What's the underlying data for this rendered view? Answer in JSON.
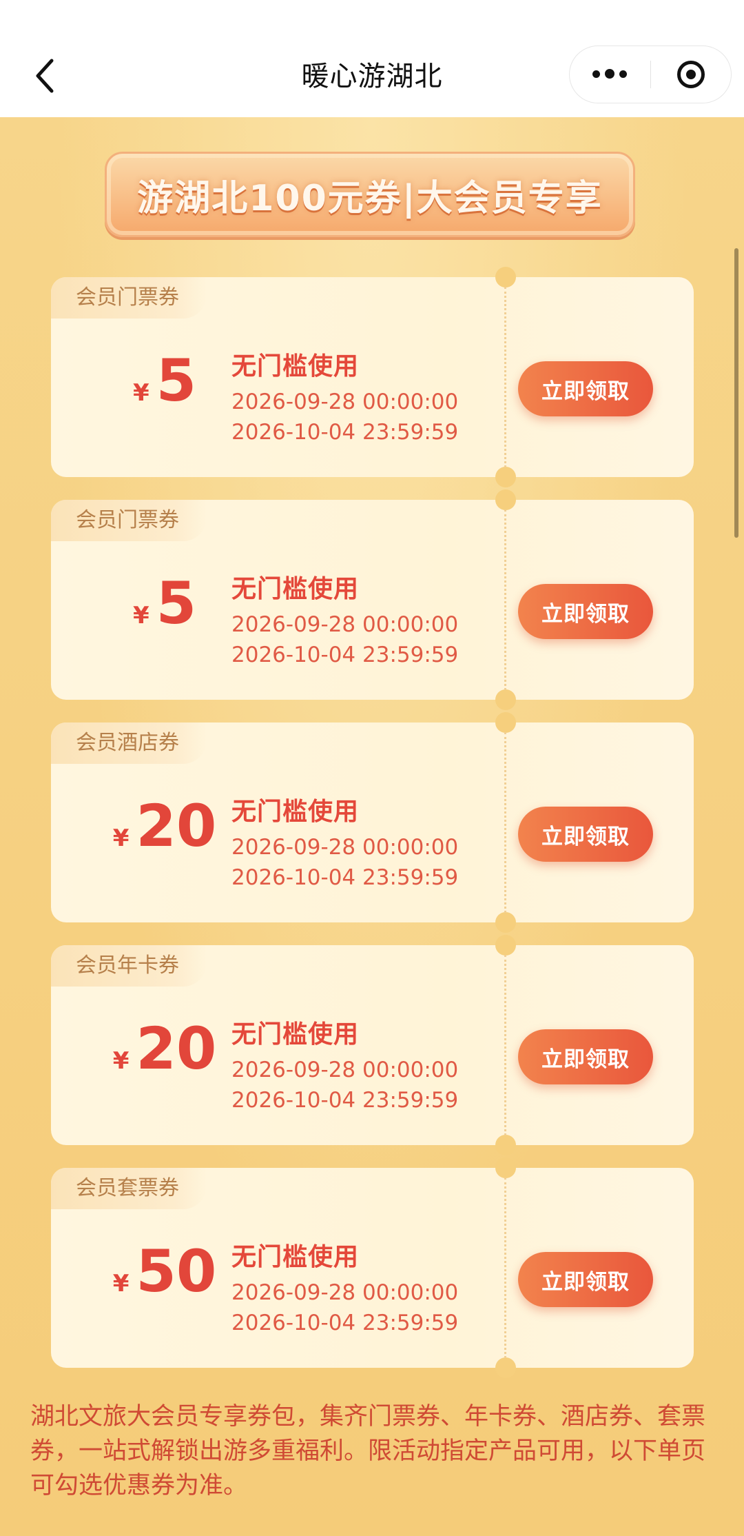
{
  "header": {
    "title": "暖心游湖北",
    "back_icon": "chevron-left-icon",
    "more_icon": "more-dots-icon",
    "close_icon": "target-circle-icon"
  },
  "banner": {
    "text": "游湖北100元券|大会员专享"
  },
  "coupons": [
    {
      "tag": "会员门票券",
      "currency": "¥",
      "amount": "5",
      "rule": "无门槛使用",
      "start": "2026-09-28 00:00:00",
      "end": "2026-10-04 23:59:59",
      "button": "立即领取"
    },
    {
      "tag": "会员门票券",
      "currency": "¥",
      "amount": "5",
      "rule": "无门槛使用",
      "start": "2026-09-28 00:00:00",
      "end": "2026-10-04 23:59:59",
      "button": "立即领取"
    },
    {
      "tag": "会员酒店券",
      "currency": "¥",
      "amount": "20",
      "rule": "无门槛使用",
      "start": "2026-09-28 00:00:00",
      "end": "2026-10-04 23:59:59",
      "button": "立即领取"
    },
    {
      "tag": "会员年卡券",
      "currency": "¥",
      "amount": "20",
      "rule": "无门槛使用",
      "start": "2026-09-28 00:00:00",
      "end": "2026-10-04 23:59:59",
      "button": "立即领取"
    },
    {
      "tag": "会员套票券",
      "currency": "¥",
      "amount": "50",
      "rule": "无门槛使用",
      "start": "2026-09-28 00:00:00",
      "end": "2026-10-04 23:59:59",
      "button": "立即领取"
    }
  ],
  "description": "湖北文旅大会员专享券包，集齐门票券、年卡券、酒店券、套票券，一站式解锁出游多重福利。限活动指定产品可用，以下单页可勾选优惠券为准。",
  "colors": {
    "accent": "#e9573c",
    "background": "#f6cf7d",
    "text_red": "#e2463a"
  }
}
